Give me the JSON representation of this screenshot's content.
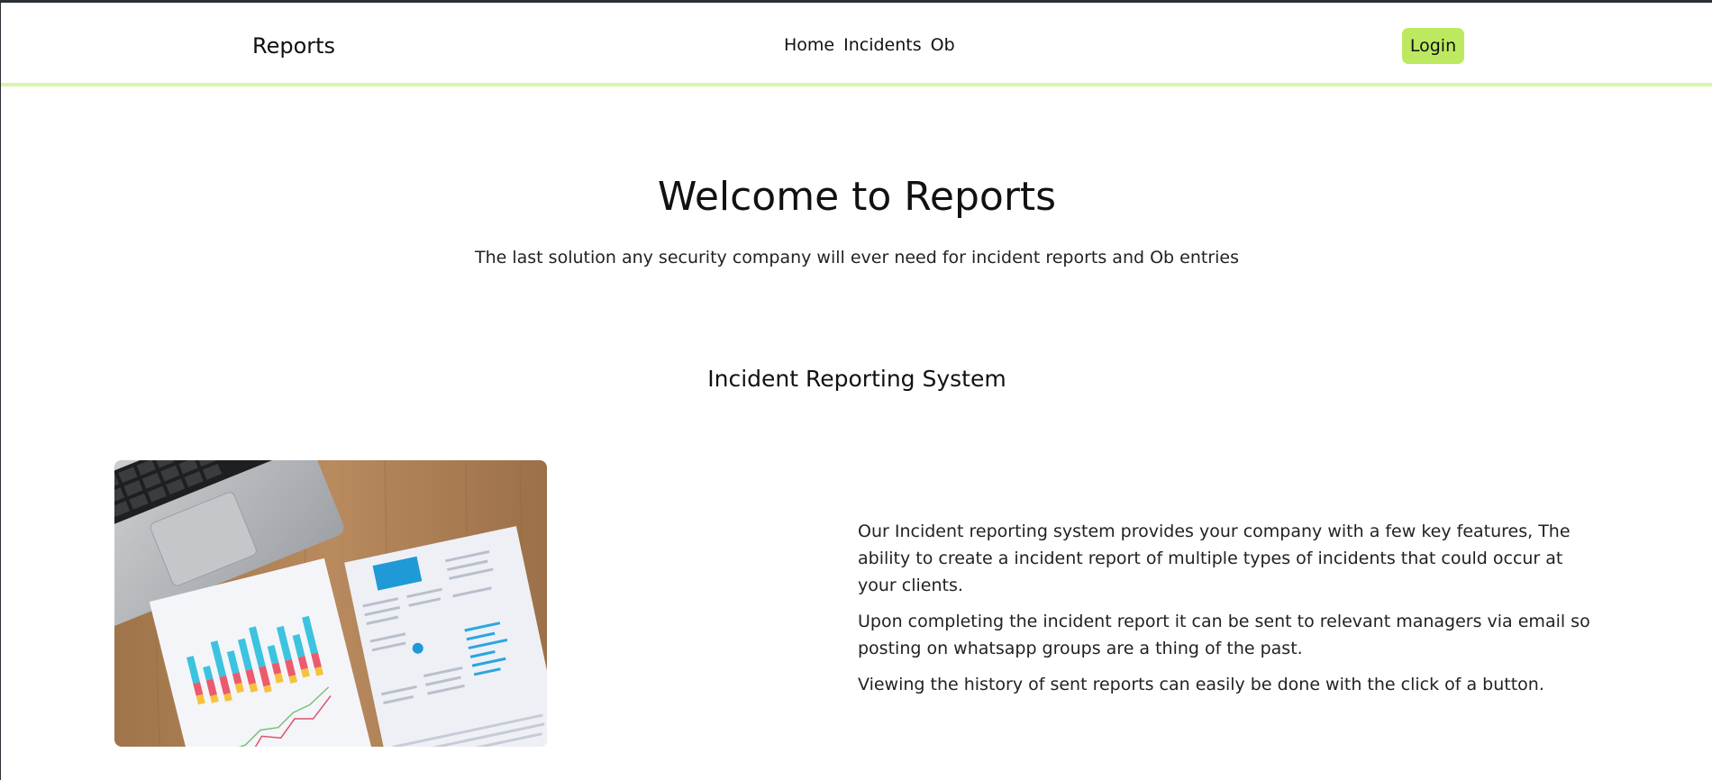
{
  "navbar": {
    "brand": "Reports",
    "links": [
      "Home",
      "Incidents",
      "Ob"
    ],
    "login_label": "Login",
    "accent_color": "#bde960",
    "border_color": "#d7f7a6"
  },
  "hero": {
    "title": "Welcome to Reports",
    "subtitle": "The last solution any security company will ever need for incident reports and Ob entries"
  },
  "feature": {
    "title": "Incident Reporting System",
    "image_icon": "laptop-charts-photo",
    "paragraphs": [
      "Our Incident reporting system provides your company with a few key features, The ability to create a incident report of multiple types of incidents that could occur at your clients.",
      "Upon completing the incident report it can be sent to relevant managers via email so posting on whatsapp groups are a thing of the past.",
      "Viewing the history of sent reports can easily be done with the click of a button."
    ]
  }
}
